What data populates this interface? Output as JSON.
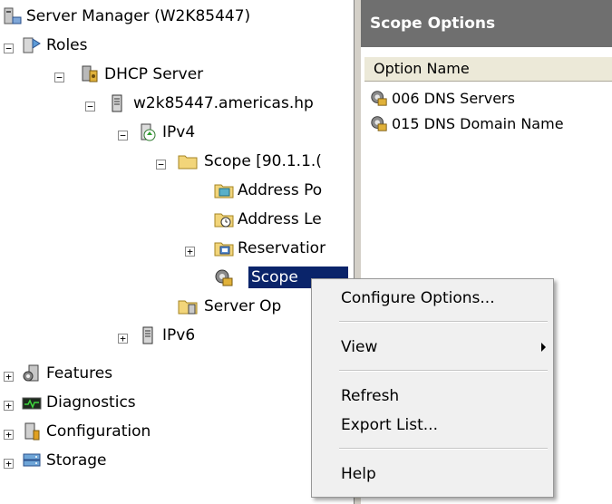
{
  "tree": {
    "server_manager": "Server Manager (W2K85447)",
    "roles": "Roles",
    "dhcp_server": "DHCP Server",
    "server_node": "w2k85447.americas.hp",
    "ipv4": "IPv4",
    "scope": "Scope [90.1.1.(",
    "address_pool": "Address Po",
    "address_leases": "Address Le",
    "reservations": "Reservatior",
    "scope_options": "Scope",
    "server_options": "Server Op",
    "ipv6": "IPv6",
    "features": "Features",
    "diagnostics": "Diagnostics",
    "configuration": "Configuration",
    "storage": "Storage",
    "expand_plus": "+",
    "collapse_minus": "−"
  },
  "right_pane": {
    "title": "Scope Options",
    "column_header": "Option Name",
    "options": [
      {
        "label": "006 DNS Servers",
        "icon": "dns-option-icon"
      },
      {
        "label": "015 DNS Domain Name",
        "icon": "dns-option-icon"
      }
    ]
  },
  "context_menu": {
    "configure_options": "Configure Options...",
    "view": "View",
    "refresh": "Refresh",
    "export_list": "Export List...",
    "help": "Help"
  },
  "colors": {
    "selection": "#0a246a",
    "pane_header": "#6f6f6f",
    "menu_bg": "#f0f0f0"
  }
}
